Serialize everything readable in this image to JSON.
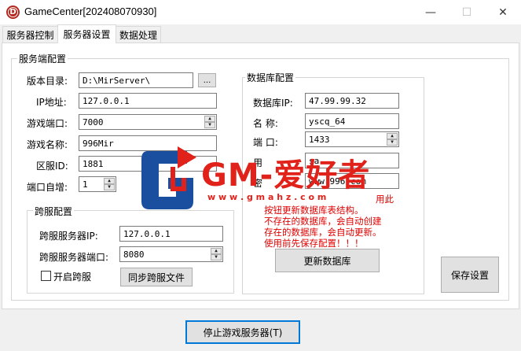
{
  "window": {
    "title": "GameCenter[202408070930]",
    "icon_letter": "D",
    "minimize": "—",
    "maximize": "☐",
    "close": "✕"
  },
  "tabs": [
    {
      "label": "服务器控制",
      "active": false
    },
    {
      "label": "服务器设置",
      "active": true
    },
    {
      "label": "数据处理",
      "active": false
    }
  ],
  "server_config": {
    "title": "服务端配置",
    "version_dir_label": "版本目录:",
    "version_dir_value": "D:\\MirServer\\",
    "browse_label": "...",
    "ip_label": "IP地址:",
    "ip_value": "127.0.0.1",
    "port_label": "游戏端口:",
    "port_value": "7000",
    "name_label": "游戏名称:",
    "name_value": "996Mir",
    "zone_label": "区服ID:",
    "zone_value": "1881",
    "autoinc_label": "端口自增:",
    "autoinc_value": "1"
  },
  "cross_config": {
    "title": "跨服配置",
    "ip_label": "跨服服务器IP:",
    "ip_value": "127.0.0.1",
    "port_label": "跨服服务器端口:",
    "port_value": "8080",
    "enable_label": "开启跨服",
    "enable_checked": false,
    "sync_label": "同步跨服文件"
  },
  "db_config": {
    "title": "数据库配置",
    "ip_label": "数据库IP:",
    "ip_value": "47.99.99.32",
    "name_label": "名    称:",
    "name_value": "yscq_64",
    "port_label": "端    口:",
    "port_value": "1433",
    "user_label": "用",
    "user_value": "sa",
    "pass_label": "密",
    "pass_value": "www.996.com",
    "note_lines": [
      "用此",
      "按钮更新数据库表结构。",
      "不存在的数据库，会自动创建",
      "存在的数据库，会自动更新。",
      "使用前先保存配置！！！"
    ],
    "update_label": "更新数据库"
  },
  "save_label": "保存设置",
  "stop_label": "停止游戏服务器(T)",
  "watermark": {
    "brand": "GM-爱好者",
    "url": "w w w . g m a h z . c o m",
    "red": "#e0221b",
    "blue": "#1a4fa0"
  }
}
